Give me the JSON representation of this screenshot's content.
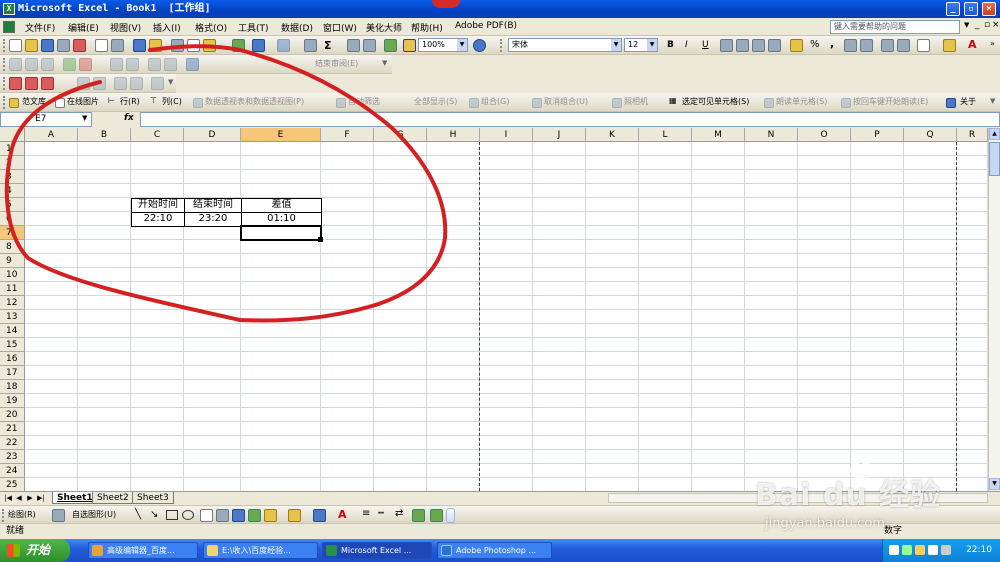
{
  "window": {
    "title": "Microsoft Excel - Book1  [工作组]",
    "app_icon": "excel-icon"
  },
  "menubar": {
    "items": [
      "文件(F)",
      "编辑(E)",
      "视图(V)",
      "插入(I)",
      "格式(O)",
      "工具(T)",
      "数据(D)",
      "窗口(W)",
      "美化大师",
      "帮助(H)",
      "Adobe PDF(B)"
    ],
    "help_placeholder": "键入需要帮助的问题"
  },
  "toolbar_standard": {
    "zoom": "100%",
    "font": "宋体",
    "font_size": "12",
    "bold": "B",
    "italic": "I",
    "underline": "U",
    "percent": "%",
    "comma": ","
  },
  "toolbar_review": {
    "items": [
      "结束审阅(E)"
    ]
  },
  "toolbar_extra": {
    "items": [
      "范文库",
      "在线图片",
      "行(R)",
      "列(C)",
      "数据透视表和数据透视图(P)",
      "自动筛选",
      "全部显示(S)",
      "组合(G)",
      "取消组合(U)",
      "照相机",
      "选定可见单元格(S)",
      "朗读单元格(S)",
      "按回车键开始朗读(E)",
      "关于"
    ]
  },
  "formula_bar": {
    "name_box": "E7",
    "fx": "fx",
    "value": ""
  },
  "sheet": {
    "columns": [
      "A",
      "B",
      "C",
      "D",
      "E",
      "F",
      "G",
      "H",
      "I",
      "J",
      "K",
      "L",
      "M",
      "N",
      "O",
      "P",
      "Q",
      "R"
    ],
    "rows": [
      "1",
      "2",
      "3",
      "4",
      "5",
      "6",
      "7",
      "8",
      "9",
      "10",
      "11",
      "12",
      "13",
      "14",
      "15",
      "16",
      "17",
      "18",
      "19",
      "20",
      "21",
      "22",
      "23",
      "24",
      "25"
    ],
    "selected_column": "E",
    "selected_row": "7",
    "table": {
      "headers": [
        "开始时间",
        "结束时间",
        "差值"
      ],
      "values": [
        "22:10",
        "23:20",
        "01:10"
      ]
    }
  },
  "sheet_tabs": [
    "Sheet1",
    "Sheet2",
    "Sheet3"
  ],
  "drawing_toolbar": {
    "draw": "绘图(R)",
    "autoshapes": "自选图形(U)"
  },
  "status": {
    "left": "就绪",
    "right": "数字"
  },
  "taskbar": {
    "start": "开始",
    "tasks": [
      "高级编辑器_百度...",
      "E:\\收入\\百度经验...",
      "Microsoft Excel ...",
      "Adobe Photoshop ..."
    ],
    "active_task": 2,
    "clock": "22:10"
  },
  "watermark": {
    "brand": "Bai du 经验",
    "url": "jingyan.baidu.com"
  },
  "annotation": {
    "color": "#d42020"
  }
}
